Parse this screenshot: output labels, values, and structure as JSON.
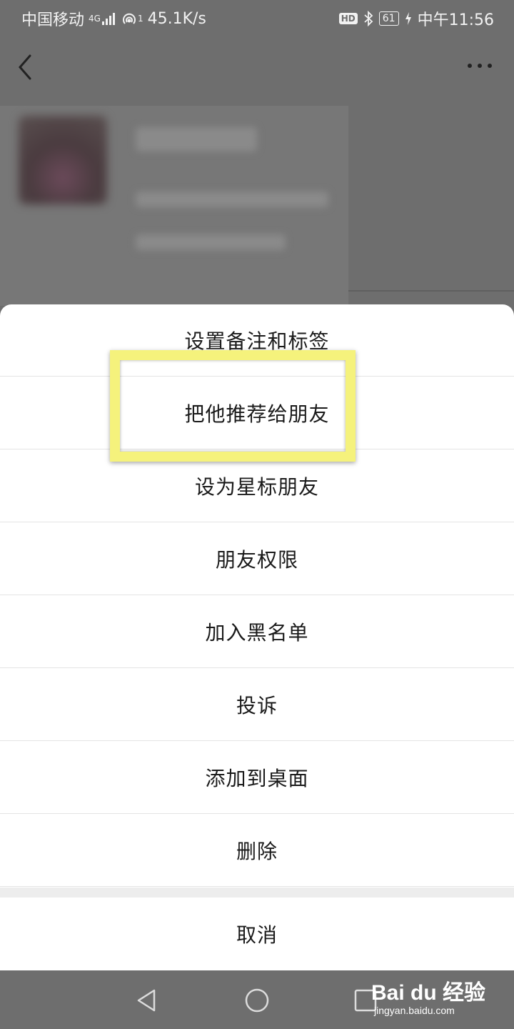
{
  "status_bar": {
    "carrier": "中国移动",
    "network_badge": "4G",
    "hotspot_count": "1",
    "speed": "45.1K/s",
    "hd_badge": "HD",
    "battery": "61",
    "time": "中午11:56"
  },
  "icons": {
    "back": "chevron-left-icon",
    "more": "more-horizontal-icon",
    "nav_back": "triangle-back-icon",
    "nav_home": "circle-home-icon",
    "nav_recent": "square-recent-icon"
  },
  "action_sheet": {
    "items": [
      {
        "label": "设置备注和标签"
      },
      {
        "label": "把他推荐给朋友"
      },
      {
        "label": "设为星标朋友"
      },
      {
        "label": "朋友权限"
      },
      {
        "label": "加入黑名单"
      },
      {
        "label": "投诉"
      },
      {
        "label": "添加到桌面"
      },
      {
        "label": "删除"
      }
    ],
    "cancel_label": "取消"
  },
  "highlight": {
    "color": "#f5f27c",
    "target_item": "把他推荐给朋友"
  },
  "watermark": {
    "brand": "Bai du 经验",
    "url": "jingyan.baidu.com"
  }
}
